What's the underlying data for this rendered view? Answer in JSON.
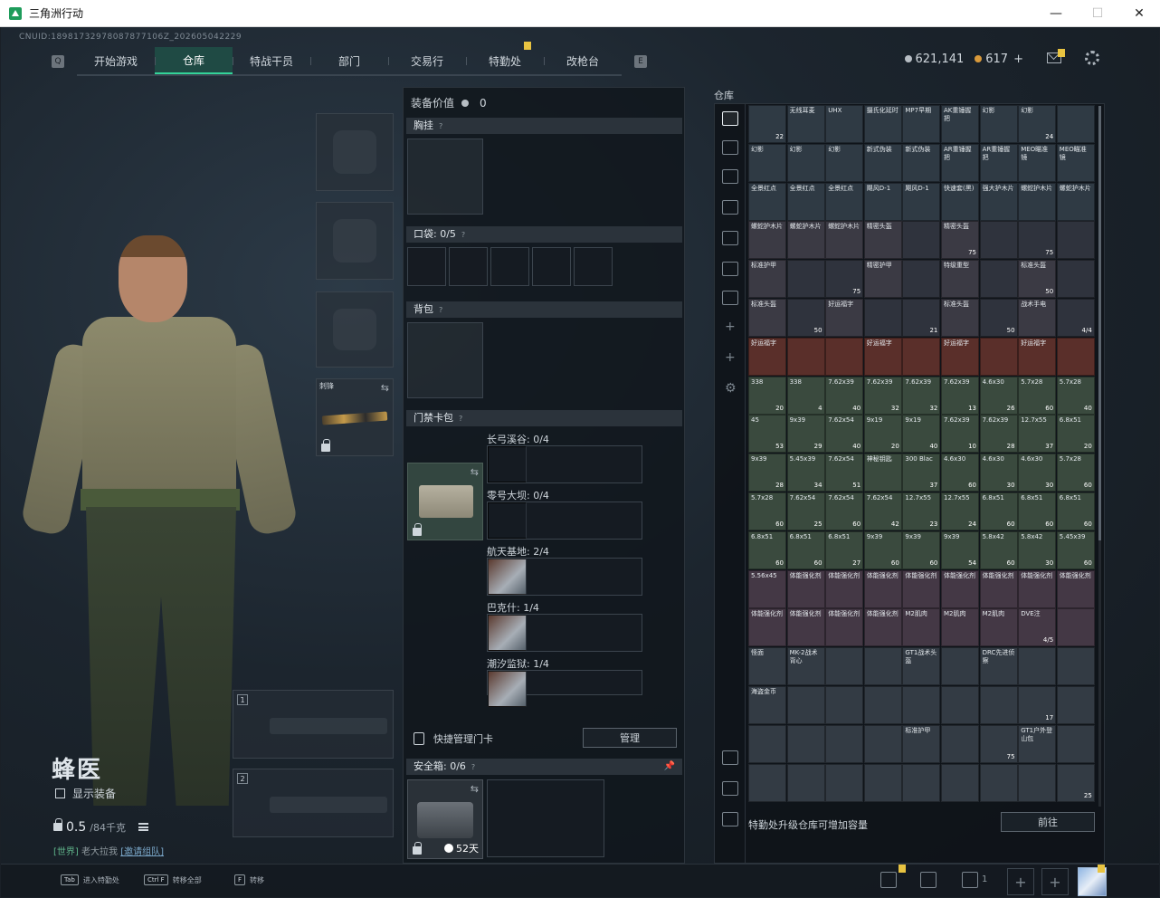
{
  "window": {
    "title": "三角洲行动",
    "minimize": "—",
    "maximize": "☐",
    "close": "✕"
  },
  "uid": "CNUID:18981732978087877106Z_202605042229",
  "nav": {
    "tabs": [
      "开始游戏",
      "仓库",
      "特战干员",
      "部门",
      "交易行",
      "特勤处",
      "改枪台"
    ],
    "active": "仓库",
    "badge_tab": "特勤处"
  },
  "currency": {
    "silver": "621,141",
    "gold": "617",
    "plus": "+"
  },
  "operator": {
    "name": "蜂医",
    "show_equipment": "显示装备",
    "weight": "0.5",
    "weight_max": "/84千克"
  },
  "chat": {
    "channel": "[世界]",
    "user": "老大拉我",
    "link": "[邀请组队]"
  },
  "equipment": {
    "melee_label": "刺锋",
    "weapon_slot_1": "1",
    "weapon_slot_2": "2"
  },
  "middle": {
    "value_label": "装备价值",
    "value": "0",
    "chest_rig": "胸挂",
    "pocket": "口袋:",
    "pocket_count": "0/5",
    "backpack": "背包",
    "keycard_bag": "门禁卡包",
    "maps": [
      {
        "name": "长弓溪谷",
        "count": "0/4",
        "filled": 0
      },
      {
        "name": "零号大坝",
        "count": "0/4",
        "filled": 0
      },
      {
        "name": "航天基地",
        "count": "2/4",
        "filled": 2
      },
      {
        "name": "巴克什",
        "count": "1/4",
        "filled": 1
      },
      {
        "name": "潮汐监狱",
        "count": "1/4",
        "filled": 1
      }
    ],
    "quick_manage": "快捷管理门卡",
    "manage_btn": "管理",
    "safebox": "安全箱:",
    "safebox_count": "0/6",
    "safebox_days": "52天"
  },
  "storage": {
    "label": "仓库",
    "footer": "特勤处升级仓库可增加容量",
    "goto": "前往",
    "rows": [
      [
        [
          "",
          "22"
        ],
        [
          "无线耳麦",
          ""
        ],
        [
          "UHX",
          ""
        ],
        [
          "摄氏化延时",
          ""
        ],
        [
          "MP7早期",
          ""
        ],
        [
          "AK重锤握把",
          ""
        ],
        [
          "幻影",
          ""
        ],
        [
          "幻影",
          "24"
        ],
        [
          "",
          ""
        ]
      ],
      [
        [
          "幻影",
          ""
        ],
        [
          "幻影",
          ""
        ],
        [
          "幻影",
          ""
        ],
        [
          "新式伪装",
          ""
        ],
        [
          "新式伪装",
          ""
        ],
        [
          "AR重锤握把",
          ""
        ],
        [
          "AR重锤握把",
          ""
        ],
        [
          "MEO瞄准镜",
          ""
        ],
        [
          "MEO瞄准镜",
          ""
        ]
      ],
      [
        [
          "全景红点",
          ""
        ],
        [
          "全景红点",
          ""
        ],
        [
          "全景红点",
          ""
        ],
        [
          "飓风D-1",
          ""
        ],
        [
          "飓风D-1",
          ""
        ],
        [
          "快速套(黑)",
          ""
        ],
        [
          "强大护木片",
          ""
        ],
        [
          "螺蛇护木片",
          ""
        ],
        [
          "螺蛇护木片",
          ""
        ]
      ],
      [
        [
          "螺蛇护木片",
          ""
        ],
        [
          "螺蛇护木片",
          ""
        ],
        [
          "螺蛇护木片",
          ""
        ],
        [
          "精密头盔",
          ""
        ],
        [
          "",
          ""
        ],
        [
          "精密头盔",
          "75"
        ],
        [
          "",
          ""
        ],
        [
          "",
          "75"
        ],
        [
          "",
          ""
        ]
      ],
      [
        [
          "标准护甲",
          ""
        ],
        [
          "",
          ""
        ],
        [
          "",
          "75"
        ],
        [
          "精密护甲",
          ""
        ],
        [
          "",
          ""
        ],
        [
          "特级重型",
          ""
        ],
        [
          "",
          ""
        ],
        [
          "标准头盔",
          "50"
        ],
        [
          "",
          ""
        ]
      ],
      [
        [
          "标准头盔",
          ""
        ],
        [
          "",
          "50"
        ],
        [
          "好运福字",
          ""
        ],
        [
          "",
          ""
        ],
        [
          "",
          "21"
        ],
        [
          "标准头盔",
          ""
        ],
        [
          "",
          "50"
        ],
        [
          "战术手电",
          ""
        ],
        [
          "",
          "4/4"
        ]
      ],
      [
        [
          "好运福字",
          ""
        ],
        [
          "",
          ""
        ],
        [
          "",
          ""
        ],
        [
          "好运福字",
          ""
        ],
        [
          "",
          ""
        ],
        [
          "好运福字",
          ""
        ],
        [
          "",
          ""
        ],
        [
          "好运福字",
          ""
        ],
        [
          "",
          ""
        ]
      ],
      [
        [
          "338",
          "20"
        ],
        [
          "338",
          "4"
        ],
        [
          "7.62x39",
          "40"
        ],
        [
          "7.62x39",
          "32"
        ],
        [
          "7.62x39",
          "32"
        ],
        [
          "7.62x39",
          "13"
        ],
        [
          "4.6x30",
          "26"
        ],
        [
          "5.7x28",
          "60"
        ],
        [
          "5.7x28",
          "40"
        ]
      ],
      [
        [
          "45",
          "53"
        ],
        [
          "9x39",
          "29"
        ],
        [
          "7.62x54",
          "40"
        ],
        [
          "9x19",
          "20"
        ],
        [
          "9x19",
          "40"
        ],
        [
          "7.62x39",
          "10"
        ],
        [
          "7.62x39",
          "28"
        ],
        [
          "12.7x55",
          "37"
        ],
        [
          "6.8x51",
          "20"
        ]
      ],
      [
        [
          "9x39",
          "28"
        ],
        [
          "5.45x39",
          "34"
        ],
        [
          "7.62x54",
          "51"
        ],
        [
          "神秘钥匙",
          ""
        ],
        [
          "300 Blac",
          "37"
        ],
        [
          "4.6x30",
          "60"
        ],
        [
          "4.6x30",
          "30"
        ],
        [
          "4.6x30",
          "30"
        ],
        [
          "5.7x28",
          "60"
        ]
      ],
      [
        [
          "5.7x28",
          "60"
        ],
        [
          "7.62x54",
          "25"
        ],
        [
          "7.62x54",
          "60"
        ],
        [
          "7.62x54",
          "42"
        ],
        [
          "12.7x55",
          "23"
        ],
        [
          "12.7x55",
          "24"
        ],
        [
          "6.8x51",
          "60"
        ],
        [
          "6.8x51",
          "60"
        ],
        [
          "6.8x51",
          "60"
        ]
      ],
      [
        [
          "6.8x51",
          "60"
        ],
        [
          "6.8x51",
          "60"
        ],
        [
          "6.8x51",
          "27"
        ],
        [
          "9x39",
          "60"
        ],
        [
          "9x39",
          "60"
        ],
        [
          "9x39",
          "54"
        ],
        [
          "5.8x42",
          "60"
        ],
        [
          "5.8x42",
          "30"
        ],
        [
          "5.45x39",
          "60"
        ]
      ],
      [
        [
          "5.56x45",
          ""
        ],
        [
          "体能强化剂",
          ""
        ],
        [
          "体能强化剂",
          ""
        ],
        [
          "体能强化剂",
          ""
        ],
        [
          "体能强化剂",
          ""
        ],
        [
          "体能强化剂",
          ""
        ],
        [
          "体能强化剂",
          ""
        ],
        [
          "体能强化剂",
          ""
        ],
        [
          "体能强化剂",
          ""
        ]
      ],
      [
        [
          "体能强化剂",
          ""
        ],
        [
          "体能强化剂",
          ""
        ],
        [
          "体能强化剂",
          ""
        ],
        [
          "体能强化剂",
          ""
        ],
        [
          "M2肌肉",
          ""
        ],
        [
          "M2肌肉",
          ""
        ],
        [
          "M2肌肉",
          ""
        ],
        [
          "DVE注",
          "4/5"
        ],
        [
          "",
          ""
        ]
      ],
      [
        [
          "怪面",
          ""
        ],
        [
          "MK-2战术背心",
          ""
        ],
        [
          "",
          ""
        ],
        [
          "",
          ""
        ],
        [
          "GT1战术头盔",
          ""
        ],
        [
          "",
          ""
        ],
        [
          "DRC先进侦察",
          ""
        ],
        [
          "",
          ""
        ],
        [
          "",
          ""
        ]
      ],
      [
        [
          "海盗金币",
          ""
        ],
        [
          "",
          ""
        ],
        [
          "",
          ""
        ],
        [
          "",
          ""
        ],
        [
          "",
          ""
        ],
        [
          "",
          ""
        ],
        [
          "",
          ""
        ],
        [
          "",
          "17"
        ],
        [
          "",
          ""
        ]
      ],
      [
        [
          "",
          ""
        ],
        [
          "",
          ""
        ],
        [
          "",
          ""
        ],
        [
          "",
          ""
        ],
        [
          "标准护甲",
          ""
        ],
        [
          "",
          ""
        ],
        [
          "",
          "75"
        ],
        [
          "GT1户外登山包",
          ""
        ],
        [
          "",
          ""
        ]
      ],
      [
        [
          "",
          ""
        ],
        [
          "",
          ""
        ],
        [
          "",
          ""
        ],
        [
          "",
          ""
        ],
        [
          "",
          ""
        ],
        [
          "",
          ""
        ],
        [
          "",
          ""
        ],
        [
          "",
          ""
        ],
        [
          "",
          "25"
        ]
      ]
    ]
  },
  "bottom": {
    "hints": [
      {
        "key": "Tab",
        "text": "进入特勤处"
      },
      {
        "key": "Ctrl F",
        "text": "转移全部"
      },
      {
        "key": "F",
        "text": "转移"
      }
    ],
    "friends": "1"
  }
}
